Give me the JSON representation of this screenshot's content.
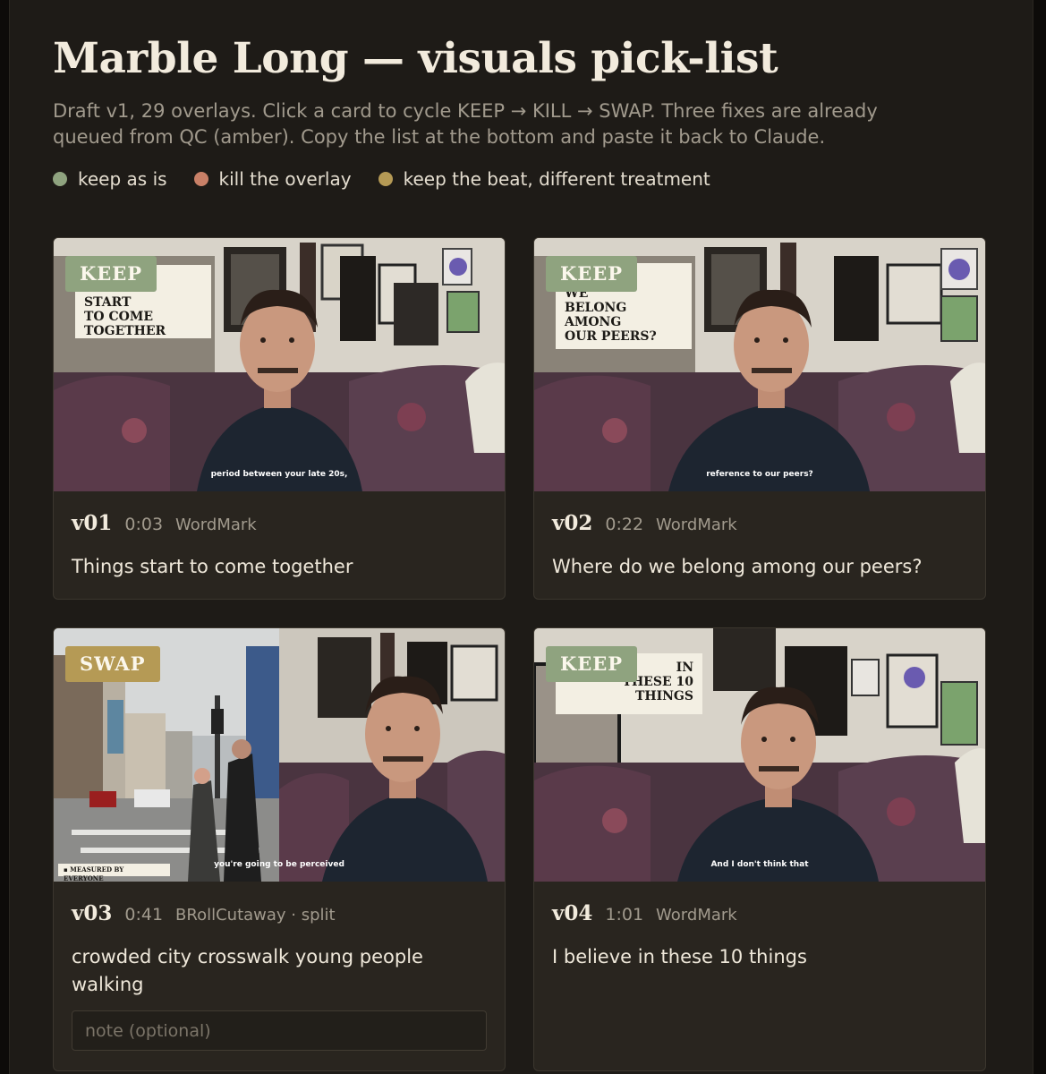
{
  "title": "Marble Long — visuals pick-list",
  "subtitle": "Draft v1, 29 overlays. Click a card to cycle KEEP → KILL → SWAP. Three fixes are already queued from QC (amber). Copy the list at the bottom and paste it back to Claude.",
  "colors": {
    "keep": "#8fa37f",
    "kill": "#c98067",
    "swap": "#b59a55"
  },
  "legend": [
    {
      "label": "keep as is",
      "color": "#8fa37f"
    },
    {
      "label": "kill the overlay",
      "color": "#c98067"
    },
    {
      "label": "keep the beat, different treatment",
      "color": "#b59a55"
    }
  ],
  "cards": [
    {
      "id": "v01",
      "time": "0:03",
      "type": "WordMark",
      "description": "Things start to come together",
      "status": "KEEP",
      "thumbnail": {
        "overlay_text": "START\nTO COME\nTOGETHER",
        "caption": "period between your late 20s,"
      }
    },
    {
      "id": "v02",
      "time": "0:22",
      "type": "WordMark",
      "description": "Where do we belong among our peers?",
      "status": "KEEP",
      "thumbnail": {
        "overlay_text": "WE\nBELONG\nAMONG\nOUR PEERS?",
        "caption": "reference to our peers?"
      }
    },
    {
      "id": "v03",
      "time": "0:41",
      "type": "BRollCutaway · split",
      "description": "crowded city crosswalk young people walking",
      "status": "SWAP",
      "note_placeholder": "note (optional)",
      "thumbnail": {
        "overlay_text": "▪ MEASURED BY EVERYONE",
        "caption": "you're going to be perceived"
      }
    },
    {
      "id": "v04",
      "time": "1:01",
      "type": "WordMark",
      "description": "I believe in these 10 things",
      "status": "KEEP",
      "thumbnail": {
        "overlay_text": "IN\nTHESE 10\nTHINGS",
        "caption": "And I don't think that"
      }
    }
  ]
}
